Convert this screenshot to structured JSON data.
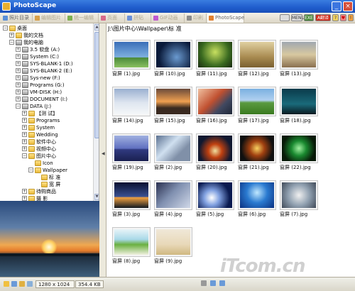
{
  "window": {
    "title": "PhotoScape",
    "minimize": "_",
    "close": "×"
  },
  "tabs": [
    {
      "label": "照片目录",
      "color": "#5a8fd8",
      "active": true
    },
    {
      "label": "编辑图片",
      "color": "#d8a04a",
      "active": false
    },
    {
      "label": "统一编辑",
      "color": "#7cb050",
      "active": false
    },
    {
      "label": "页面",
      "color": "#d86a8a",
      "active": false
    },
    {
      "label": "拼贴",
      "color": "#6a8fd8",
      "active": false
    },
    {
      "label": "GIF动画",
      "color": "#c05ad0",
      "active": false
    },
    {
      "label": "印刷",
      "color": "#8a8a8a",
      "active": false
    },
    {
      "label": "PhotoScape",
      "color": "#e08030",
      "active": true
    }
  ],
  "toolbar_buttons": [
    "",
    "MENU",
    "EXE",
    "A翻译",
    "?",
    "♥",
    "!"
  ],
  "tree": [
    {
      "label": "桌面",
      "indent": 0,
      "expander": "−",
      "icon": "folder"
    },
    {
      "label": "我的文档",
      "indent": 1,
      "expander": "+",
      "icon": "folder"
    },
    {
      "label": "我的电脑",
      "indent": 1,
      "expander": "−",
      "icon": "drive"
    },
    {
      "label": "3.5 软盘 (A:)",
      "indent": 2,
      "expander": "+",
      "icon": "drive"
    },
    {
      "label": "System (C:)",
      "indent": 2,
      "expander": "+",
      "icon": "drive"
    },
    {
      "label": "SYS-BLANK-1 (D:)",
      "indent": 2,
      "expander": "+",
      "icon": "drive"
    },
    {
      "label": "SYS-BLANK-2 (E:)",
      "indent": 2,
      "expander": "+",
      "icon": "drive"
    },
    {
      "label": "Sys-new (F:)",
      "indent": 2,
      "expander": "+",
      "icon": "drive"
    },
    {
      "label": "Programs (G:)",
      "indent": 2,
      "expander": "+",
      "icon": "drive"
    },
    {
      "label": "VM-DISK (H:)",
      "indent": 2,
      "expander": "+",
      "icon": "drive"
    },
    {
      "label": "DOCUMENT (I:)",
      "indent": 2,
      "expander": "+",
      "icon": "drive"
    },
    {
      "label": "DATA (J:)",
      "indent": 2,
      "expander": "−",
      "icon": "drive"
    },
    {
      "label": "【测 试】",
      "indent": 3,
      "expander": "+",
      "icon": "folder"
    },
    {
      "label": "Programs",
      "indent": 3,
      "expander": "+",
      "icon": "folder"
    },
    {
      "label": "System",
      "indent": 3,
      "expander": "+",
      "icon": "folder"
    },
    {
      "label": "Wedding",
      "indent": 3,
      "expander": "+",
      "icon": "folder"
    },
    {
      "label": "软件中心",
      "indent": 3,
      "expander": "+",
      "icon": "folder"
    },
    {
      "label": "视频中心",
      "indent": 3,
      "expander": "+",
      "icon": "folder"
    },
    {
      "label": "图片中心",
      "indent": 3,
      "expander": "−",
      "icon": "folder"
    },
    {
      "label": "Icon",
      "indent": 4,
      "expander": "",
      "icon": "folder"
    },
    {
      "label": "Wallpaper",
      "indent": 4,
      "expander": "−",
      "icon": "folder"
    },
    {
      "label": "标  准",
      "indent": 5,
      "expander": "",
      "icon": "folder"
    },
    {
      "label": "宽  屏",
      "indent": 5,
      "expander": "",
      "icon": "folder"
    },
    {
      "label": "待购商品",
      "indent": 3,
      "expander": "+",
      "icon": "folder"
    },
    {
      "label": "摄  影",
      "indent": 3,
      "expander": "+",
      "icon": "folder"
    }
  ],
  "path": "J:\\图片中心\\Wallpaper\\标  准",
  "thumbnails": [
    {
      "caption": "窗屏 (1).jpg",
      "bg": "linear-gradient(#3a6fb8,#7fb0e0 60%,#4a8a3a 62%,#8ac060)"
    },
    {
      "caption": "窗屏 (10).jpg",
      "bg": "radial-gradient(circle at 60% 60%,#6a9ad0,#0a1a3a 70%)"
    },
    {
      "caption": "窗屏 (11).jpg",
      "bg": "radial-gradient(circle at 50% 40%,#c8e060,#3a6a20 60%,#1a2a10)"
    },
    {
      "caption": "窗屏 (12).jpg",
      "bg": "linear-gradient(#e0d0a0,#a88a50 60%,#7a6030)"
    },
    {
      "caption": "窗屏 (13).jpg",
      "bg": "linear-gradient(#a0a8b0,#d8c8a0 50%,#8a7050)"
    },
    {
      "caption": "窗屏 (14).jpg",
      "bg": "linear-gradient(#9ab0d0,#dfe6f0 55%,#f4f6f8)"
    },
    {
      "caption": "窗屏 (15).jpg",
      "bg": "linear-gradient(#6a4a3a,#f0a050 50%,#3a2a20 75%)"
    },
    {
      "caption": "窗屏 (16).jpg",
      "bg": "linear-gradient(135deg,#f0c0a0,#c05030 45%,#404860 70%,#202838)"
    },
    {
      "caption": "窗屏 (17).jpg",
      "bg": "linear-gradient(#7ab0e0,#b0d0f0 45%,#5a9a40 55%,#3a7a20)"
    },
    {
      "caption": "窗屏 (18).jpg",
      "bg": "linear-gradient(#0a3a4a,#1a6a7a 60%,#0a1a20)"
    },
    {
      "caption": "窗屏 (19).jpg",
      "bg": "linear-gradient(#a0b0e0,#6070c0 50%,#303a80 55%,#1a2050)"
    },
    {
      "caption": "窗屏 (2).jpg",
      "bg": "linear-gradient(135deg,#5a7090,#d0e0f0 40%,#8090a8 70%)"
    },
    {
      "caption": "窗屏 (20).jpg",
      "bg": "radial-gradient(circle at 50% 60%,#f0e0a0,#c04010 30%,#101830 70%)"
    },
    {
      "caption": "窗屏 (21).jpg",
      "bg": "radial-gradient(circle at 50% 50%,#f8d060,#a04010 35%,#101010 75%)"
    },
    {
      "caption": "窗屏 (22).jpg",
      "bg": "radial-gradient(circle at 50% 50%,#a0f0a0,#1a8a30 35%,#081a08 75%)"
    },
    {
      "caption": "窗屏 (3).jpg",
      "bg": "linear-gradient(#0a1030,#3a5090 55%,#f0a040 60%,#101820)"
    },
    {
      "caption": "窗屏 (4).jpg",
      "bg": "linear-gradient(135deg,#2a3050,#8090b0 45%,#d0d8e8)"
    },
    {
      "caption": "窗屏 (5).jpg",
      "bg": "radial-gradient(circle at 40% 60%,#ffffff,#80a0e0 30%,#0a1a50 70%)"
    },
    {
      "caption": "窗屏 (6).jpg",
      "bg": "radial-gradient(circle at 50% 40%,#c0e8ff,#2a7ad0 45%,#0a3080)"
    },
    {
      "caption": "窗屏 (7).jpg",
      "bg": "radial-gradient(circle at 50% 50%,#f0f0f0,#90a0b0 50%,#404a58)"
    },
    {
      "caption": "窗屏 (8).jpg",
      "bg": "linear-gradient(#e8f4f8,#a8d8e8 40%,#6ab040 60%,#f0f0e0)"
    },
    {
      "caption": "窗屏 (9).jpg",
      "bg": "linear-gradient(#f0e8d8,#e8d8b8 60%,#d0b880)"
    }
  ],
  "status": {
    "dimensions": "1280 x 1024",
    "filesize": "354.4 KB"
  },
  "watermark": "iTcom.cn"
}
